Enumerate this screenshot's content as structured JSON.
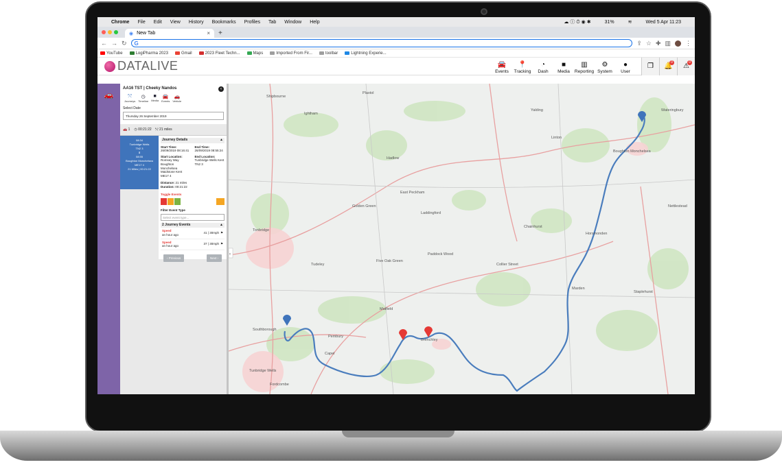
{
  "mac_menubar": {
    "app": "Chrome",
    "menus": [
      "File",
      "Edit",
      "View",
      "History",
      "Bookmarks",
      "Profiles",
      "Tab",
      "Window",
      "Help"
    ],
    "battery": "31%",
    "datetime": "Wed 5 Apr  11:23"
  },
  "browser": {
    "tab_title": "New Tab",
    "url": "",
    "bookmarks": [
      {
        "label": "YouTube",
        "color": "#ff0000"
      },
      {
        "label": "LogiPharma 2023",
        "color": "#2e7d32"
      },
      {
        "label": "Gmail",
        "color": "#ea4335"
      },
      {
        "label": "2023 Fleet Techn...",
        "color": "#d32f2f"
      },
      {
        "label": "Maps",
        "color": "#34a853"
      },
      {
        "label": "Imported From Fir...",
        "color": "#9e9e9e"
      },
      {
        "label": "toolbar",
        "color": "#9e9e9e"
      },
      {
        "label": "Lightning Experie...",
        "color": "#1e88e5"
      }
    ]
  },
  "app": {
    "brand": "DATALIVE",
    "nav": [
      {
        "label": "Events",
        "icon": "car-icon"
      },
      {
        "label": "Tracking",
        "icon": "pin-icon"
      },
      {
        "label": "Dash",
        "icon": "gauge-icon"
      },
      {
        "label": "Media",
        "icon": "video-icon"
      },
      {
        "label": "Reporting",
        "icon": "chart-icon"
      },
      {
        "label": "System",
        "icon": "gear-icon"
      },
      {
        "label": "User",
        "icon": "user-icon"
      }
    ],
    "alert_badges": [
      "0",
      "0"
    ]
  },
  "panel": {
    "title": "AA16 TST | Cheeky Nandos",
    "icons": [
      "Journeys",
      "Timeline",
      "Media",
      "Events",
      "Vehicle"
    ],
    "select_date_label": "Select Date",
    "selected_date": "Thursday 26 September 2019",
    "stats": {
      "journeys": "1",
      "duration": "00:21:22",
      "distance": "21 miles"
    },
    "journey_card": {
      "start_time": "08:34",
      "start_place": "Tunbridge Wells",
      "start_postcode": "TN2 3",
      "end_time": "08:55",
      "end_place": "Boughton Monchelsea",
      "end_postcode": "ME17 4",
      "distance": "21 Miles | 00:21:22"
    },
    "details": {
      "header": "Journey Details",
      "start_time_label": "Start Time:",
      "start_time": "26/09/2019 08:16:41",
      "end_time_label": "End Time:",
      "end_time": "26/09/2019 08:55:24",
      "start_location_label": "Start Location:",
      "start_location": "Romsey Way Boughton Monchelsea Maidstone Kent ME17 4",
      "end_location_label": "End Location:",
      "end_location": "Tunbridge Wells Kent TN2 3",
      "distance_label": "Distance:",
      "distance": "21 miles",
      "duration_label": "Duration:",
      "duration": "00:21:22",
      "toggle_label": "Toggle Events",
      "event_type_label": "Filter Event Type",
      "event_type_placeholder": "Select event type..."
    },
    "events": {
      "header": "2 Journey Events",
      "rows": [
        {
          "type": "Speed",
          "time": "an hour ago",
          "speed": "41 | 30mph"
        },
        {
          "type": "Speed",
          "time": "an hour ago",
          "speed": "37 | 30mph"
        }
      ]
    },
    "prev_label": "Previous",
    "next_label": "Next"
  },
  "map": {
    "places": [
      "Shipbourne",
      "Ightham",
      "Plaxtol",
      "Hadlow",
      "Tonbridge",
      "East Peckham",
      "Golden Green",
      "Paddock Wood",
      "Horsmonden",
      "Marden",
      "Staplehurst",
      "Yalding",
      "Laddingford",
      "Southborough",
      "Tunbridge Wells",
      "Pembury",
      "Brenchley",
      "Matfield",
      "Five Oak Green",
      "Chainhurst",
      "Collier Street",
      "Boughton Monchelsea",
      "Linton",
      "Tudeley",
      "Capel",
      "Fordcombe",
      "Wateringbury",
      "Nettlestead"
    ]
  }
}
